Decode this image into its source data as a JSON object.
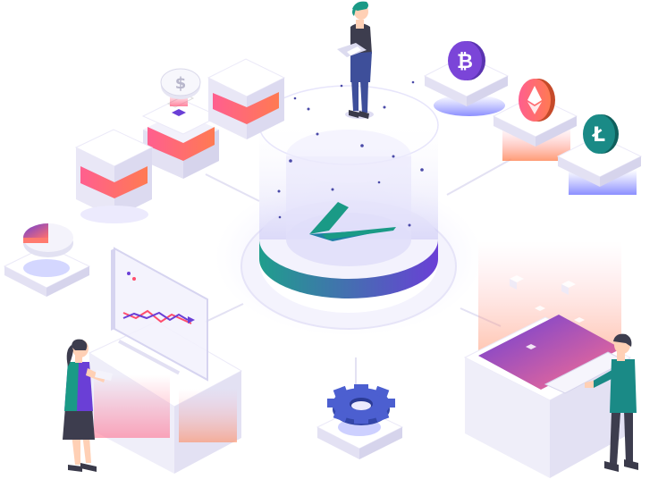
{
  "colors": {
    "background": "#ffffff",
    "platform_top": "#f1f0fb",
    "platform_side": "#e2e0f3",
    "gradient_teal": "#1f9e8c",
    "gradient_purple": "#6a3fd6",
    "gradient_pink": "#ff5f8f",
    "gradient_orange": "#ff7a52",
    "bitcoin_purple": "#7b45d8",
    "ethereum_orange": "#f2702f",
    "litecoin_teal": "#1a8a86",
    "gear_blue": "#4c5fd0",
    "logo_teal": "#1a9a86",
    "line_chart_red": "#ff4d6d",
    "line_chart_purple": "#6a3fd6"
  },
  "icons": {
    "coin_dollar": "$",
    "coin_bitcoin": "₿",
    "coin_litecoin": "Ł"
  }
}
